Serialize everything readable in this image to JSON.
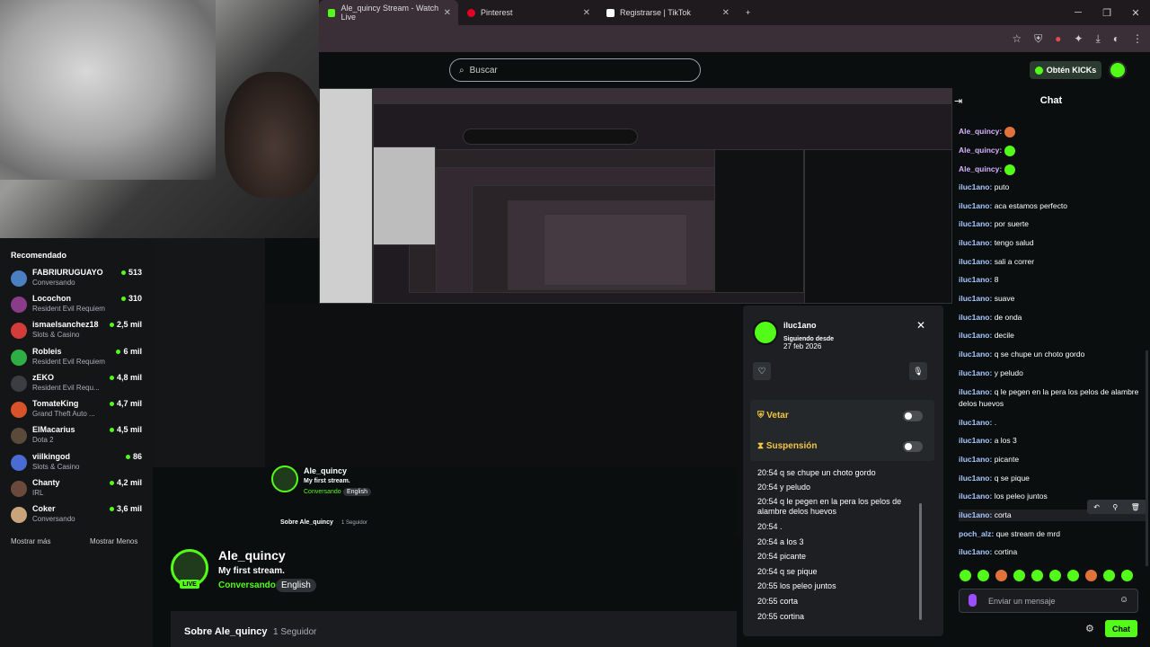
{
  "browser": {
    "tabs": [
      {
        "label": "Ale_quincy Stream - Watch Live",
        "favicon_color": "#53fc18",
        "active": true
      },
      {
        "label": "Pinterest",
        "favicon_color": "#e60023",
        "active": false
      },
      {
        "label": "Registrarse | TikTok",
        "favicon_color": "#ffffff",
        "active": false
      }
    ],
    "new_tab": "+"
  },
  "kick": {
    "search_placeholder": "Buscar",
    "kicks_button": "Obtén KICKs"
  },
  "sidebar": {
    "heading": "Recomendado",
    "items": [
      {
        "name": "FABRIURUGUAYO",
        "category": "Conversando",
        "viewers": "513",
        "avatar_color": "#4a7fc1"
      },
      {
        "name": "Locochon",
        "category": "Resident Evil Requiem",
        "viewers": "310",
        "avatar_color": "#8a3c8a"
      },
      {
        "name": "ismaelsanchez18",
        "category": "Slots & Casino",
        "viewers": "2,5 mil",
        "avatar_color": "#d43b3b"
      },
      {
        "name": "Robleis",
        "category": "Resident Evil Requiem",
        "viewers": "6 mil",
        "avatar_color": "#2fae45"
      },
      {
        "name": "zEKO",
        "category": "Resident Evil Requ...",
        "viewers": "4,8 mil",
        "avatar_color": "#3a3d42"
      },
      {
        "name": "TomateKing",
        "category": "Grand Theft Auto ...",
        "viewers": "4,7 mil",
        "avatar_color": "#d9532a"
      },
      {
        "name": "ElMacarius",
        "category": "Dota 2",
        "viewers": "4,5 mil",
        "avatar_color": "#5a4a3a"
      },
      {
        "name": "viilkingod",
        "category": "Slots & Casino",
        "viewers": "86",
        "avatar_color": "#4a6ad4"
      },
      {
        "name": "Chanty",
        "category": "IRL",
        "viewers": "4,2 mil",
        "avatar_color": "#6a4a3a"
      },
      {
        "name": "Coker",
        "category": "Conversando",
        "viewers": "3,6 mil",
        "avatar_color": "#c9a37a"
      }
    ],
    "show_more": "Mostrar más",
    "show_less": "Mostrar Menos"
  },
  "channel": {
    "name": "Ale_quincy",
    "title": "My first stream.",
    "category": "Conversando",
    "language": "English",
    "live": "LIVE",
    "about": "Sobre Ale_quincy",
    "followers": "1 Seguidor"
  },
  "usercard": {
    "username": "iluc1ano",
    "following_since_label": "Siguiendo desde",
    "following_since": "27 feb 2026",
    "ban_label": "Vetar",
    "timeout_label": "Suspensión",
    "log": [
      "20:54 q se chupe un choto gordo",
      "20:54 y peludo",
      "20:54 q le pegen en la pera los pelos de alambre delos huevos",
      "20:54 .",
      "20:54 a los 3",
      "20:54 picante",
      "20:54 q se pique",
      "20:55 los peleo juntos",
      "20:55 corta",
      "20:55 cortina"
    ]
  },
  "chat": {
    "title": "Chat",
    "messages": [
      {
        "user": "Ale_quincy:",
        "text": "",
        "emote": "#e0733a",
        "color": "purple"
      },
      {
        "user": "Ale_quincy:",
        "text": "",
        "emote": "#53fc18",
        "color": "purple"
      },
      {
        "user": "Ale_quincy:",
        "text": "",
        "emote": "#53fc18",
        "color": "purple"
      },
      {
        "user": "iluc1ano:",
        "text": "puto",
        "color": "blue"
      },
      {
        "user": "iluc1ano:",
        "text": "aca estamos perfecto",
        "color": "blue"
      },
      {
        "user": "iluc1ano:",
        "text": "por suerte",
        "color": "blue"
      },
      {
        "user": "iluc1ano:",
        "text": "tengo salud",
        "color": "blue"
      },
      {
        "user": "iluc1ano:",
        "text": "sali a correr",
        "color": "blue"
      },
      {
        "user": "iluc1ano:",
        "text": "8",
        "color": "blue"
      },
      {
        "user": "iluc1ano:",
        "text": "suave",
        "color": "blue"
      },
      {
        "user": "iluc1ano:",
        "text": "de onda",
        "color": "blue"
      },
      {
        "user": "iluc1ano:",
        "text": "decile",
        "color": "blue"
      },
      {
        "user": "iluc1ano:",
        "text": "q se chupe un choto gordo",
        "color": "blue"
      },
      {
        "user": "iluc1ano:",
        "text": "y peludo",
        "color": "blue"
      },
      {
        "user": "iluc1ano:",
        "text": "q le pegen en la pera los pelos de alambre delos huevos",
        "color": "blue"
      },
      {
        "user": "iluc1ano:",
        "text": ".",
        "color": "blue"
      },
      {
        "user": "iluc1ano:",
        "text": "a los 3",
        "color": "blue"
      },
      {
        "user": "iluc1ano:",
        "text": "picante",
        "color": "blue"
      },
      {
        "user": "iluc1ano:",
        "text": "q se pique",
        "color": "blue"
      },
      {
        "user": "iluc1ano:",
        "text": "los peleo juntos",
        "color": "blue"
      },
      {
        "user": "iluc1ano:",
        "text": "corta",
        "color": "blue"
      },
      {
        "user": "poch_alz:",
        "text": "que stream de mrd",
        "color": "blue"
      },
      {
        "user": "iluc1ano:",
        "text": "cortina",
        "color": "blue"
      }
    ],
    "input_placeholder": "Enviar un mensaje",
    "send_label": "Chat"
  }
}
